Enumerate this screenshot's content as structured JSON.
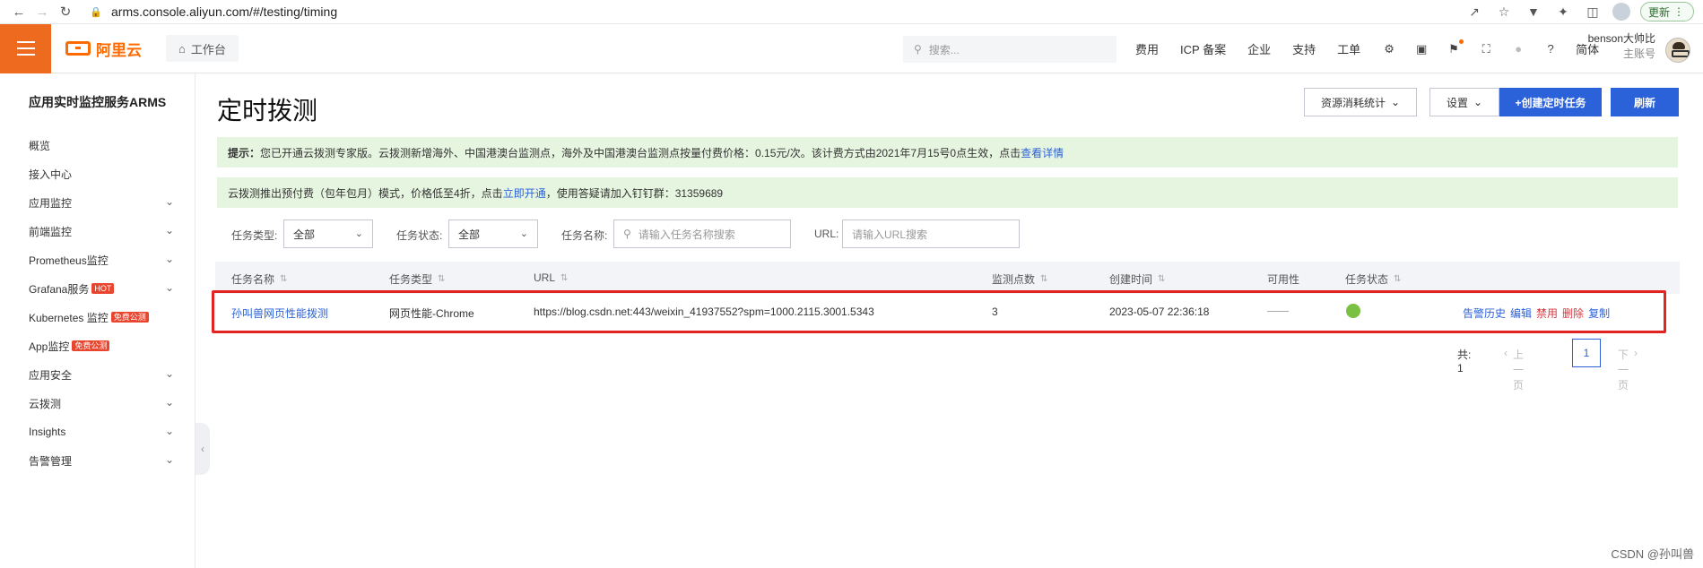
{
  "browser": {
    "url": "arms.console.aliyun.com/#/testing/timing",
    "update_label": "更新"
  },
  "topnav": {
    "logo_text": "阿里云",
    "workbench": "工作台",
    "search_placeholder": "搜索...",
    "links": [
      "费用",
      "ICP 备案",
      "企业",
      "支持",
      "工单"
    ],
    "lang": "简体",
    "user_name": "benson大帅比",
    "user_sub": "主账号"
  },
  "sidebar": {
    "title": "应用实时监控服务ARMS",
    "items": [
      {
        "label": "概览",
        "chevron": false,
        "badge": ""
      },
      {
        "label": "接入中心",
        "chevron": false,
        "badge": ""
      },
      {
        "label": "应用监控",
        "chevron": true,
        "badge": ""
      },
      {
        "label": "前端监控",
        "chevron": true,
        "badge": ""
      },
      {
        "label": "Prometheus监控",
        "chevron": true,
        "badge": ""
      },
      {
        "label": "Grafana服务",
        "chevron": true,
        "badge": "HOT"
      },
      {
        "label": "Kubernetes 监控",
        "chevron": false,
        "badge": "免费公测"
      },
      {
        "label": "App监控",
        "chevron": false,
        "badge": "免费公测"
      },
      {
        "label": "应用安全",
        "chevron": true,
        "badge": ""
      },
      {
        "label": "云拨测",
        "chevron": true,
        "badge": ""
      },
      {
        "label": "Insights",
        "chevron": true,
        "badge": ""
      },
      {
        "label": "告警管理",
        "chevron": true,
        "badge": ""
      }
    ]
  },
  "main": {
    "title": "定时拨测",
    "buttons": {
      "usage": "资源消耗统计",
      "settings": "设置",
      "create": "+创建定时任务",
      "refresh": "刷新"
    },
    "notice1": {
      "prefix": "提示：",
      "text": "您已开通云拨测专家版。云拨测新增海外、中国港澳台监测点，海外及中国港澳台监测点按量付费价格：0.15元/次。该计费方式由2021年7月15号0点生效，点击",
      "link": "查看详情"
    },
    "notice2": {
      "text1": "云拨测推出预付费（包年包月）模式，价格低至4折，点击",
      "link": "立即开通",
      "text2": "，使用答疑请加入钉钉群：31359689"
    },
    "filters": {
      "type_label": "任务类型:",
      "type_value": "全部",
      "status_label": "任务状态:",
      "status_value": "全部",
      "name_label": "任务名称:",
      "name_placeholder": "请输入任务名称搜索",
      "url_label": "URL:",
      "url_placeholder": "请输入URL搜索"
    },
    "table": {
      "headers": [
        "任务名称",
        "任务类型",
        "URL",
        "监测点数",
        "创建时间",
        "可用性",
        "任务状态"
      ],
      "rows": [
        {
          "name": "孙叫兽网页性能拨测",
          "type": "网页性能-Chrome",
          "url": "https://blog.csdn.net:443/weixin_41937552?spm=1000.2115.3001.5343",
          "points": "3",
          "created": "2023-05-07 22:36:18",
          "availability": "",
          "status": "enabled",
          "actions": [
            "告警历史",
            "编辑",
            "禁用",
            "删除",
            "复制"
          ]
        }
      ]
    },
    "pager": {
      "total": "共: 1",
      "prev": "上一页",
      "current": "1",
      "next": "下一页"
    }
  },
  "watermark": "CSDN @孙叫兽",
  "colors": {
    "brand_orange": "#ff6a00",
    "primary_blue": "#2c62d9",
    "notice_green": "#e6f5df",
    "status_green": "#7ac143",
    "highlight_red": "#e32222"
  }
}
